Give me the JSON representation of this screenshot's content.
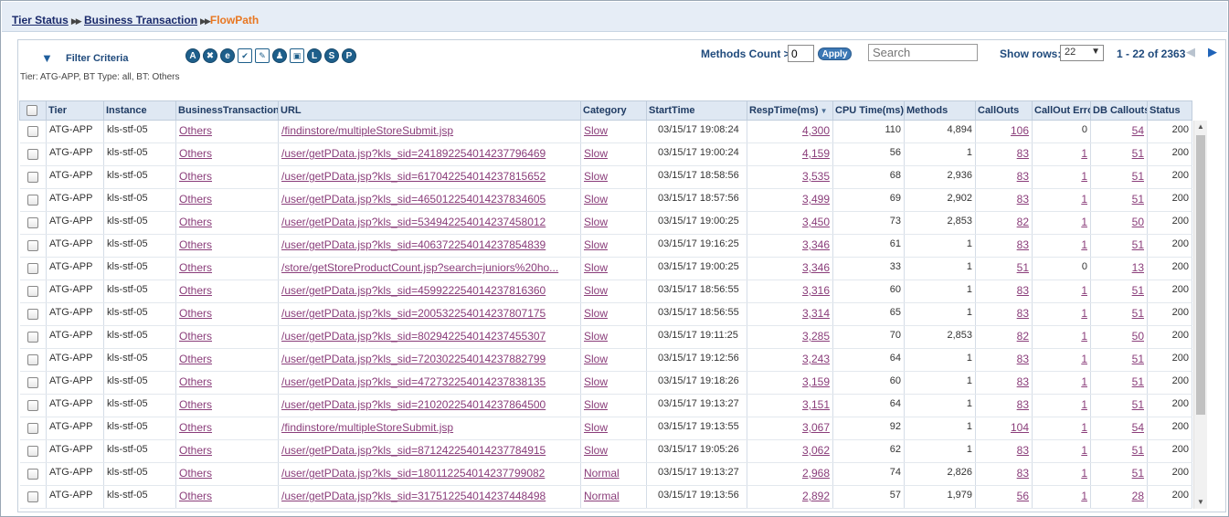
{
  "breadcrumb": {
    "items": [
      "Tier Status",
      "Business Transaction"
    ],
    "current": "FlowPath",
    "separator": "▶▶"
  },
  "filter": {
    "toggle_icon": "triangle-down-icon",
    "title": "Filter Criteria",
    "summary": "Tier: ATG-APP, BT Type: all, BT: Others",
    "icons": [
      {
        "name": "a-icon",
        "glyph": "A"
      },
      {
        "name": "shuffle-icon",
        "glyph": "✖"
      },
      {
        "name": "e-icon",
        "glyph": "e"
      },
      {
        "name": "diamond-check-icon",
        "glyph": "✔"
      },
      {
        "name": "edit-doc-icon",
        "glyph": "✎"
      },
      {
        "name": "users-icon",
        "glyph": "♟"
      },
      {
        "name": "window-icon",
        "glyph": "▣"
      },
      {
        "name": "l-icon",
        "glyph": "L"
      },
      {
        "name": "s-icon",
        "glyph": "S"
      },
      {
        "name": "p-icon",
        "glyph": "P"
      }
    ]
  },
  "controls": {
    "methods_count_label": "Methods Count >",
    "methods_count_value": "0",
    "apply_label": "Apply",
    "search_placeholder": "Search",
    "show_rows_label": "Show rows:",
    "show_rows_value": "22",
    "pager_info": "1 - 22 of 2363",
    "prev_icon": "◀",
    "next_icon": "▶"
  },
  "table": {
    "columns": [
      "Tier",
      "Instance",
      "BusinessTransaction",
      "URL",
      "Category",
      "StartTime",
      "RespTime(ms)",
      "CPU Time(ms)",
      "Methods",
      "CallOuts",
      "CallOut Erro",
      "DB Callouts",
      "Status"
    ],
    "sort_column": "RespTime(ms)",
    "rows": [
      [
        "ATG-APP",
        "kls-stf-05",
        "Others",
        "/findinstore/multipleStoreSubmit.jsp",
        "Slow",
        "03/15/17 19:08:24",
        "4,300",
        "110",
        "4,894",
        "106",
        "0",
        "54",
        "200"
      ],
      [
        "ATG-APP",
        "kls-stf-05",
        "Others",
        "/user/getPData.jsp?kls_sid=241892254014237796469",
        "Slow",
        "03/15/17 19:00:24",
        "4,159",
        "56",
        "1",
        "83",
        "1",
        "51",
        "200"
      ],
      [
        "ATG-APP",
        "kls-stf-05",
        "Others",
        "/user/getPData.jsp?kls_sid=617042254014237815652",
        "Slow",
        "03/15/17 18:58:56",
        "3,535",
        "68",
        "2,936",
        "83",
        "1",
        "51",
        "200"
      ],
      [
        "ATG-APP",
        "kls-stf-05",
        "Others",
        "/user/getPData.jsp?kls_sid=465012254014237834605",
        "Slow",
        "03/15/17 18:57:56",
        "3,499",
        "69",
        "2,902",
        "83",
        "1",
        "51",
        "200"
      ],
      [
        "ATG-APP",
        "kls-stf-05",
        "Others",
        "/user/getPData.jsp?kls_sid=534942254014237458012",
        "Slow",
        "03/15/17 19:00:25",
        "3,450",
        "73",
        "2,853",
        "82",
        "1",
        "50",
        "200"
      ],
      [
        "ATG-APP",
        "kls-stf-05",
        "Others",
        "/user/getPData.jsp?kls_sid=406372254014237854839",
        "Slow",
        "03/15/17 19:16:25",
        "3,346",
        "61",
        "1",
        "83",
        "1",
        "51",
        "200"
      ],
      [
        "ATG-APP",
        "kls-stf-05",
        "Others",
        "/store/getStoreProductCount.jsp?search=juniors%20ho...",
        "Slow",
        "03/15/17 19:00:25",
        "3,346",
        "33",
        "1",
        "51",
        "0",
        "13",
        "200"
      ],
      [
        "ATG-APP",
        "kls-stf-05",
        "Others",
        "/user/getPData.jsp?kls_sid=459922254014237816360",
        "Slow",
        "03/15/17 18:56:55",
        "3,316",
        "60",
        "1",
        "83",
        "1",
        "51",
        "200"
      ],
      [
        "ATG-APP",
        "kls-stf-05",
        "Others",
        "/user/getPData.jsp?kls_sid=200532254014237807175",
        "Slow",
        "03/15/17 18:56:55",
        "3,314",
        "65",
        "1",
        "83",
        "1",
        "51",
        "200"
      ],
      [
        "ATG-APP",
        "kls-stf-05",
        "Others",
        "/user/getPData.jsp?kls_sid=802942254014237455307",
        "Slow",
        "03/15/17 19:11:25",
        "3,285",
        "70",
        "2,853",
        "82",
        "1",
        "50",
        "200"
      ],
      [
        "ATG-APP",
        "kls-stf-05",
        "Others",
        "/user/getPData.jsp?kls_sid=720302254014237882799",
        "Slow",
        "03/15/17 19:12:56",
        "3,243",
        "64",
        "1",
        "83",
        "1",
        "51",
        "200"
      ],
      [
        "ATG-APP",
        "kls-stf-05",
        "Others",
        "/user/getPData.jsp?kls_sid=472732254014237838135",
        "Slow",
        "03/15/17 19:18:26",
        "3,159",
        "60",
        "1",
        "83",
        "1",
        "51",
        "200"
      ],
      [
        "ATG-APP",
        "kls-stf-05",
        "Others",
        "/user/getPData.jsp?kls_sid=210202254014237864500",
        "Slow",
        "03/15/17 19:13:27",
        "3,151",
        "64",
        "1",
        "83",
        "1",
        "51",
        "200"
      ],
      [
        "ATG-APP",
        "kls-stf-05",
        "Others",
        "/findinstore/multipleStoreSubmit.jsp",
        "Slow",
        "03/15/17 19:13:55",
        "3,067",
        "92",
        "1",
        "104",
        "1",
        "54",
        "200"
      ],
      [
        "ATG-APP",
        "kls-stf-05",
        "Others",
        "/user/getPData.jsp?kls_sid=871242254014237784915",
        "Slow",
        "03/15/17 19:05:26",
        "3,062",
        "62",
        "1",
        "83",
        "1",
        "51",
        "200"
      ],
      [
        "ATG-APP",
        "kls-stf-05",
        "Others",
        "/user/getPData.jsp?kls_sid=180112254014237799082",
        "Normal",
        "03/15/17 19:13:27",
        "2,968",
        "74",
        "2,826",
        "83",
        "1",
        "51",
        "200"
      ],
      [
        "ATG-APP",
        "kls-stf-05",
        "Others",
        "/user/getPData.jsp?kls_sid=317512254014237448498",
        "Normal",
        "03/15/17 19:13:56",
        "2,892",
        "57",
        "1,979",
        "56",
        "1",
        "28",
        "200"
      ]
    ]
  },
  "scrollbar": {
    "up_icon": "▲",
    "down_icon": "▼"
  }
}
